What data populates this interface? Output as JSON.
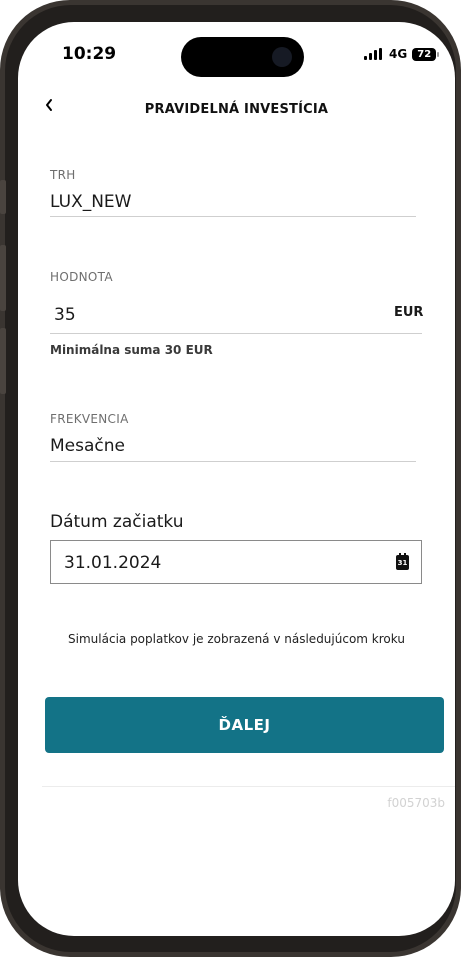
{
  "status_bar": {
    "time": "10:29",
    "network": "4G",
    "battery": "72"
  },
  "header": {
    "title": "PRAVIDELNÁ INVESTÍCIA"
  },
  "form": {
    "market": {
      "label": "TRH",
      "value": "LUX_NEW"
    },
    "amount": {
      "label": "HODNOTA",
      "value": "35",
      "currency": "EUR",
      "hint": "Minimálna suma 30 EUR"
    },
    "frequency": {
      "label": "FREKVENCIA",
      "value": "Mesačne"
    },
    "start_date": {
      "label": "Dátum začiatku",
      "value": "31.01.2024",
      "calendar_day": "31"
    }
  },
  "fee_note": "Simulácia poplatkov je zobrazená v následujúcom kroku",
  "next_button": {
    "label": "ĎALEJ"
  },
  "footer": {
    "build_id": "f005703b"
  },
  "colors": {
    "accent": "#137387",
    "frame": "#3a3531"
  },
  "icons": {
    "back": "chevron-left-icon",
    "calendar": "calendar-icon"
  }
}
